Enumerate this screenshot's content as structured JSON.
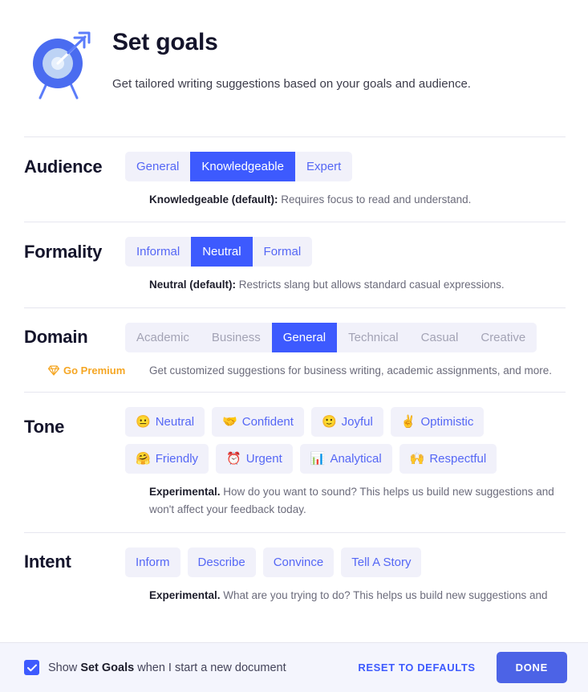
{
  "header": {
    "icon": "target-with-arrow-icon",
    "title": "Set goals",
    "subtitle": "Get tailored writing suggestions based on your goals and audience."
  },
  "sections": {
    "audience": {
      "label": "Audience",
      "options": [
        "General",
        "Knowledgeable",
        "Expert"
      ],
      "selected": "Knowledgeable",
      "help_strong": "Knowledgeable (default):",
      "help_text": " Requires focus to read and understand."
    },
    "formality": {
      "label": "Formality",
      "options": [
        "Informal",
        "Neutral",
        "Formal"
      ],
      "selected": "Neutral",
      "help_strong": "Neutral (default):",
      "help_text": " Restricts slang but allows standard casual expressions."
    },
    "domain": {
      "label": "Domain",
      "options": [
        "Academic",
        "Business",
        "General",
        "Technical",
        "Casual",
        "Creative"
      ],
      "selected": "General",
      "disabled": [
        "Academic",
        "Business",
        "Technical",
        "Casual",
        "Creative"
      ],
      "premium_label": "Go Premium",
      "premium_icon": "gem-icon",
      "help_text": "Get customized suggestions for business writing, academic assignments, and more."
    },
    "tone": {
      "label": "Tone",
      "chips": [
        {
          "emoji": "😐",
          "emoji_name": "neutral-face-emoji",
          "label": "Neutral"
        },
        {
          "emoji": "🤝",
          "emoji_name": "handshake-emoji",
          "label": "Confident"
        },
        {
          "emoji": "🙂",
          "emoji_name": "slightly-smiling-face-emoji",
          "label": "Joyful"
        },
        {
          "emoji": "✌️",
          "emoji_name": "victory-hand-emoji",
          "label": "Optimistic"
        },
        {
          "emoji": "🤗",
          "emoji_name": "hugging-face-emoji",
          "label": "Friendly"
        },
        {
          "emoji": "⏰",
          "emoji_name": "alarm-clock-emoji",
          "label": "Urgent"
        },
        {
          "emoji": "📊",
          "emoji_name": "bar-chart-emoji",
          "label": "Analytical"
        },
        {
          "emoji": "🙌",
          "emoji_name": "raising-hands-emoji",
          "label": "Respectful"
        }
      ],
      "selected": "",
      "help_strong": "Experimental.",
      "help_text": " How do you want to sound? This helps us build new suggestions and won't affect your feedback today."
    },
    "intent": {
      "label": "Intent",
      "chips": [
        "Inform",
        "Describe",
        "Convince",
        "Tell A Story"
      ],
      "selected": "",
      "help_strong": "Experimental.",
      "help_text": " What are you trying to do? This helps us build new suggestions and"
    }
  },
  "bottom_bar": {
    "checkbox_checked": true,
    "checkbox_text_before": "Show ",
    "checkbox_text_strong": "Set Goals",
    "checkbox_text_after": " when I start a new document",
    "reset_label": "RESET TO DEFAULTS",
    "done_label": "DONE"
  },
  "colors": {
    "accent_blue": "#3d5afe",
    "chip_bg": "#f1f1fa",
    "chip_text": "#5567f5",
    "premium_orange": "#f5a623",
    "bottom_bar_bg": "#f4f5fd",
    "divider": "#e6e6ef",
    "disabled_text": "#a3a3b5",
    "done_button": "#4c63e6"
  }
}
